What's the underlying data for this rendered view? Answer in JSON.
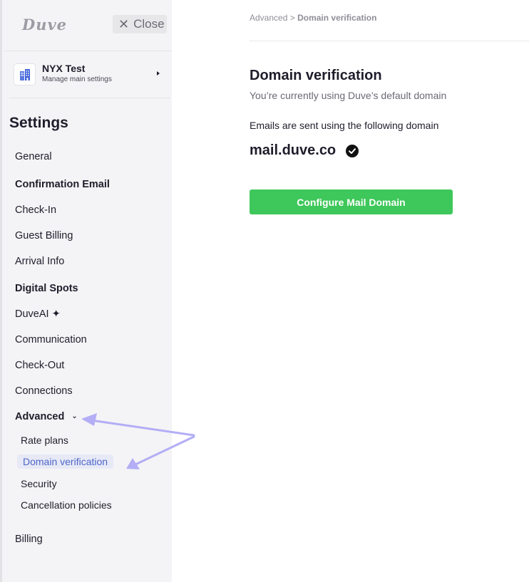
{
  "sidebar": {
    "logo": "Duve",
    "close_label": "Close",
    "property": {
      "name": "NYX Test",
      "subtitle": "Manage main settings"
    },
    "settings_title": "Settings",
    "items": [
      {
        "label": "General"
      },
      {
        "label": "Confirmation Email"
      },
      {
        "label": "Check-In"
      },
      {
        "label": "Guest Billing"
      },
      {
        "label": "Arrival Info"
      },
      {
        "label": "Digital Spots"
      },
      {
        "label": "DuveAI ✦"
      },
      {
        "label": "Communication"
      },
      {
        "label": "Check-Out"
      },
      {
        "label": "Connections"
      },
      {
        "label": "Advanced"
      },
      {
        "label": "Billing"
      }
    ],
    "advanced_sub": [
      {
        "label": "Rate plans"
      },
      {
        "label": "Domain verification"
      },
      {
        "label": "Security"
      },
      {
        "label": "Cancellation policies"
      }
    ]
  },
  "breadcrumb": {
    "parent": "Advanced",
    "separator": ">",
    "current": "Domain verification"
  },
  "main": {
    "title": "Domain verification",
    "subtitle": "You’re currently using Duve’s default domain",
    "info": "Emails are sent using the following domain",
    "domain": "mail.duve.co",
    "button_label": "Configure Mail Domain"
  },
  "colors": {
    "accent_green": "#3ec75a",
    "active_blue": "#4e66c9",
    "active_bg": "#e7e9f6",
    "annotation_arrow": "#b3aef5"
  }
}
